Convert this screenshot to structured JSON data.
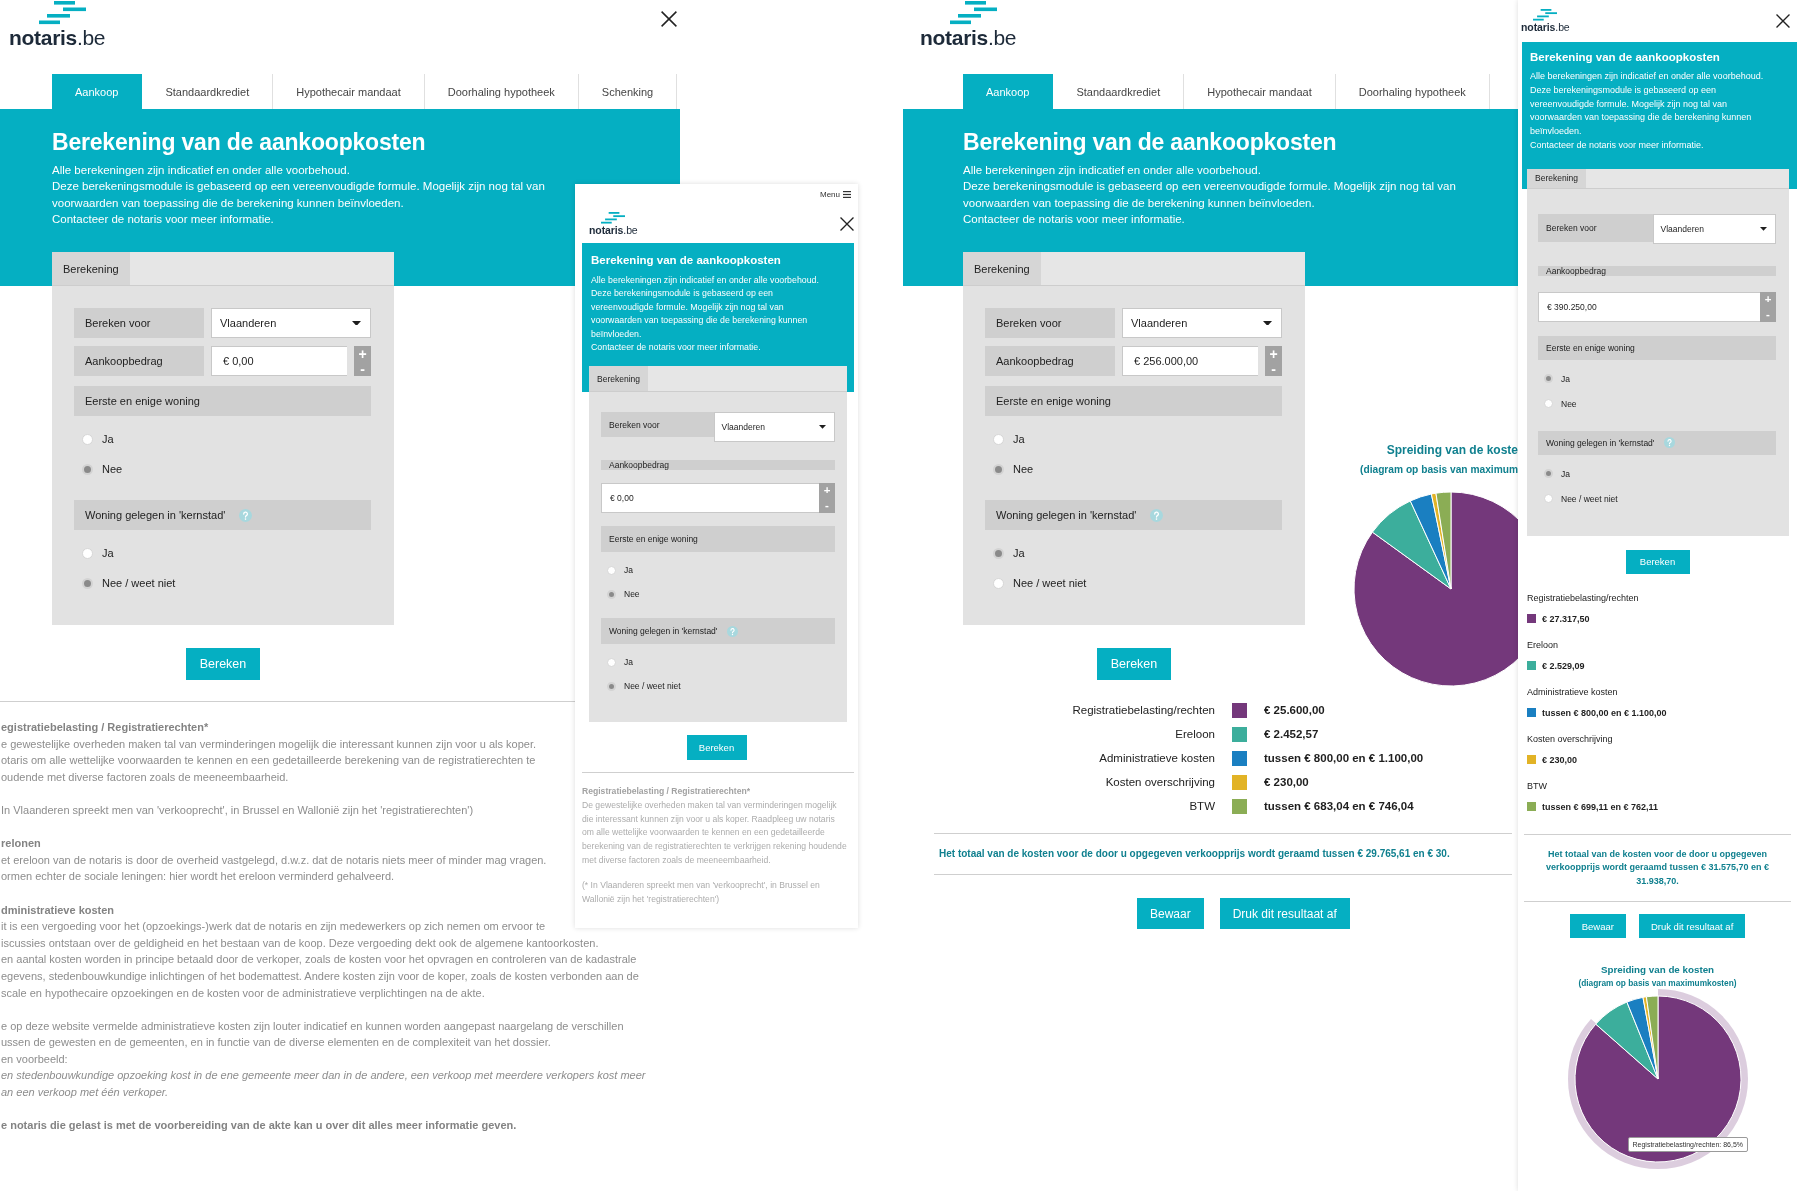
{
  "screens": [
    {
      "kind": "desktop",
      "logo": "**notaris**.be",
      "tabs": [
        {
          "label": "Aankoop",
          "selected": true
        },
        {
          "label": "Standaardkrediet",
          "selected": false
        },
        {
          "label": "Hypothecair mandaat",
          "selected": false
        },
        {
          "label": "Doorhaling hypotheek",
          "selected": false
        },
        {
          "label": "Schenking",
          "selected": false
        }
      ],
      "title": "Berekening van de aankoopkosten",
      "intro": [
        "Alle berekeningen zijn indicatief en onder alle voorbehoud.",
        "Deze berekeningsmodule is gebaseerd op een vereenvoudigde formule. Mogelijk zijn nog tal van voorwaarden van toepassing die de berekening kunnen beïnvloeden.",
        "Contacteer de notaris voor meer informatie."
      ],
      "form": {
        "tab": "Berekening",
        "region": {
          "label": "Bereken voor",
          "value": "Vlaanderen"
        },
        "amount": {
          "label": "Aankoopbedrag",
          "value": "€ 0,00",
          "step_up": "+",
          "step_down": "-"
        },
        "questions": [
          {
            "label": "Eerste en enige woning",
            "help": false,
            "options": [
              {
                "label": "Ja",
                "selected": false
              },
              {
                "label": "Nee",
                "selected": true
              }
            ]
          },
          {
            "label": "Woning gelegen in 'kernstad'",
            "help": true,
            "options": [
              {
                "label": "Ja",
                "selected": false
              },
              {
                "label": "Nee / weet niet",
                "selected": true
              }
            ]
          }
        ]
      },
      "submit": "Bereken",
      "info": [
        {
          "kind": "heading",
          "lines": [
            "egistratiebelasting / Registratierechten*"
          ]
        },
        {
          "kind": "paragraph",
          "lines": [
            "e gewestelijke overheden maken tal van verminderingen mogelijk die interessant kunnen zijn voor u als koper.",
            "otaris om alle wettelijke voorwaarden te kennen en een gedetailleerde berekening van de registratierechten te",
            "oudende met diverse factoren zoals de meeneembaarheid."
          ]
        },
        {
          "kind": "paragraph",
          "lines": [
            "In Vlaanderen spreekt men van 'verkooprecht', in Brussel en Wallonië zijn het 'registratierechten')"
          ]
        },
        {
          "kind": "heading",
          "lines": [
            "relonen"
          ]
        },
        {
          "kind": "paragraph",
          "lines": [
            "et ereloon van de notaris is door de overheid vastgelegd, d.w.z. dat de notaris niets meer of minder mag vragen.",
            "ormen echter de sociale leningen: hier wordt het ereloon verminderd gehalveerd."
          ]
        },
        {
          "kind": "heading",
          "lines": [
            "dministratieve kosten"
          ]
        },
        {
          "kind": "paragraph",
          "lines": [
            "it is een vergoeding voor het (opzoekings-)werk dat de notaris en zijn medewerkers op zich nemen om ervoor te",
            "iscussies ontstaan over de geldigheid en het bestaan van de koop. Deze vergoeding dekt ook de algemene kantoorkosten.",
            "en aantal kosten worden in principe betaald door de verkoper, zoals de kosten voor het opvragen en controleren van de kadastrale",
            "egevens, stedenbouwkundige inlichtingen of het bodemattest. Andere kosten zijn voor de koper, zoals de kosten verbonden aan de",
            "scale en hypothecaire opzoekingen en de kosten voor de administratieve verplichtingen na de akte."
          ]
        },
        {
          "kind": "paragraph",
          "lines": [
            "e op deze website vermelde administratieve kosten zijn louter indicatief en kunnen worden aangepast naargelang de verschillen",
            "ussen de gewesten en de gemeenten, en in functie van de diverse elementen en de complexiteit van het dossier.",
            "en voorbeeld:",
            "*en stedenbouwkundige opzoeking kost in de ene gemeente meer dan in de andere, een verkoop met meerdere verkopers kost meer*",
            "*an een verkoop met één verkoper.*"
          ]
        },
        {
          "kind": "closing",
          "lines": [
            "e notaris die gelast is met de voorbereiding van de akte kan u over dit alles meer informatie geven."
          ]
        }
      ]
    },
    {
      "kind": "phone",
      "menu": "Menu",
      "logo": "**notaris**.be",
      "title": "Berekening van de aankoopkosten",
      "intro": [
        "Alle berekeningen zijn indicatief en onder alle voorbehoud.",
        "Deze berekeningsmodule is gebaseerd op een vereenvoudigde formule. Mogelijk zijn nog tal van voorwaarden van toepassing die de berekening kunnen beïnvloeden.",
        "Contacteer de notaris voor meer informatie."
      ],
      "form": {
        "tab": "Berekening",
        "region": {
          "label": "Bereken voor",
          "value": "Vlaanderen"
        },
        "amount": {
          "label": "Aankoopbedrag",
          "value": "€ 0,00",
          "step_up": "+",
          "step_down": "-"
        },
        "questions": [
          {
            "label": "Eerste en enige woning",
            "help": false,
            "options": [
              {
                "label": "Ja",
                "selected": false
              },
              {
                "label": "Nee",
                "selected": true
              }
            ]
          },
          {
            "label": "Woning gelegen in 'kernstad'",
            "help": true,
            "options": [
              {
                "label": "Ja",
                "selected": false
              },
              {
                "label": "Nee / weet niet",
                "selected": true
              }
            ]
          }
        ]
      },
      "submit": "Bereken",
      "info": [
        {
          "kind": "heading",
          "lines": [
            "Registratiebelasting / Registratierechten*"
          ]
        },
        {
          "kind": "paragraph",
          "lines": [
            "De gewestelijke overheden maken tal van verminderingen mogelijk die interessant kunnen zijn voor u als koper. Raadpleeg uw notaris om alle wettelijke voorwaarden te kennen en een gedetailleerde berekening van de registratierechten te verkrijgen rekening houdende met diverse factoren zoals de meeneembaarheid."
          ]
        },
        {
          "kind": "paragraph",
          "lines": [
            "(* In Vlaanderen spreekt men van 'verkooprecht', in Brussel en Wallonië zijn het 'registratierechten')"
          ]
        }
      ]
    },
    {
      "kind": "desktop",
      "logo": "**notaris**.be",
      "tabs": [
        {
          "label": "Aankoop",
          "selected": true
        },
        {
          "label": "Standaardkrediet",
          "selected": false
        },
        {
          "label": "Hypothecair mandaat",
          "selected": false
        },
        {
          "label": "Doorhaling hypotheek",
          "selected": false
        }
      ],
      "title": "Berekening van de aankoopkosten",
      "intro": [
        "Alle berekeningen zijn indicatief en onder alle voorbehoud.",
        "Deze berekeningsmodule is gebaseerd op een vereenvoudigde formule. Mogelijk zijn nog tal van voorwaarden van toepassing die de berekening kunnen beïnvloeden.",
        "Contacteer de notaris voor meer informatie."
      ],
      "form": {
        "tab": "Berekening",
        "region": {
          "label": "Bereken voor",
          "value": "Vlaanderen"
        },
        "amount": {
          "label": "Aankoopbedrag",
          "value": "€ 256.000,00",
          "step_up": "+",
          "step_down": "-"
        },
        "questions": [
          {
            "label": "Eerste en enige woning",
            "help": false,
            "options": [
              {
                "label": "Ja",
                "selected": false
              },
              {
                "label": "Nee",
                "selected": true
              }
            ]
          },
          {
            "label": "Woning gelegen in 'kernstad'",
            "help": true,
            "options": [
              {
                "label": "Ja",
                "selected": true
              },
              {
                "label": "Nee / weet niet",
                "selected": false
              }
            ]
          }
        ]
      },
      "submit": "Bereken",
      "chart": {
        "subtitle": "(diagram op basis van maximum",
        "chart_data": {
          "type": "pie",
          "title": "Spreiding van de koste",
          "values": [
            84.97,
            8.14,
            3.65,
            0.76,
            2.48
          ]
        }
      },
      "results": {
        "items": [
          {
            "label": "Registratiebelasting/rechten",
            "color": "#74387b",
            "value": "€ 25.600,00"
          },
          {
            "label": "Ereloon",
            "color": "#3cae9c",
            "value": "€ 2.452,57"
          },
          {
            "label": "Administratieve kosten",
            "color": "#1a7fc1",
            "value": "tussen € 800,00 en € 1.100,00"
          },
          {
            "label": "Kosten overschrijving",
            "color": "#e2b326",
            "value": "€ 230,00"
          },
          {
            "label": "BTW",
            "color": "#8bad55",
            "value": "tussen € 683,04 en € 746,04"
          }
        ],
        "total": "Het totaal van de kosten voor de door u opgegeven verkoopprijs wordt geraamd tussen € 29.765,61 en € 30.",
        "actions": [
          "Bewaar",
          "Druk dit resultaat af"
        ]
      }
    },
    {
      "kind": "phone",
      "logo": "**notaris**.be",
      "title": "Berekening van de aankoopkosten",
      "intro": [
        "Alle berekeningen zijn indicatief en onder alle voorbehoud.",
        "Deze berekeningsmodule is gebaseerd op een vereenvoudigde formule. Mogelijk zijn nog tal van voorwaarden van toepassing die de berekening kunnen beïnvloeden.",
        "Contacteer de notaris voor meer informatie."
      ],
      "form": {
        "tab": "Berekening",
        "region": {
          "label": "Bereken voor",
          "value": "Vlaanderen"
        },
        "amount": {
          "label": "Aankoopbedrag",
          "value": "€ 390.250,00",
          "step_up": "+",
          "step_down": "-"
        },
        "questions": [
          {
            "label": "Eerste en enige woning",
            "help": false,
            "options": [
              {
                "label": "Ja",
                "selected": true
              },
              {
                "label": "Nee",
                "selected": false
              }
            ]
          },
          {
            "label": "Woning gelegen in 'kernstad'",
            "help": true,
            "options": [
              {
                "label": "Ja",
                "selected": true
              },
              {
                "label": "Nee / weet niet",
                "selected": false
              }
            ]
          }
        ]
      },
      "submit": "Bereken",
      "results": {
        "items": [
          {
            "label": "Registratiebelasting/rechten",
            "color": "#74387b",
            "value": "€ 27.317,50"
          },
          {
            "label": "Ereloon",
            "color": "#3cae9c",
            "value": "€ 2.529,09"
          },
          {
            "label": "Administratieve kosten",
            "color": "#1a7fc1",
            "value": "tussen € 800,00 en € 1.100,00"
          },
          {
            "label": "Kosten overschrijving",
            "color": "#e2b326",
            "value": "€ 230,00"
          },
          {
            "label": "BTW",
            "color": "#8bad55",
            "value": "tussen € 699,11 en € 762,11"
          }
        ],
        "total": "Het totaal van de kosten voor de door u opgegeven verkoopprijs wordt geraamd tussen € 31.575,70 en € 31.938,70.",
        "actions": [
          "Bewaar",
          "Druk dit resultaat af"
        ]
      },
      "chart": {
        "subtitle": "(diagram op basis van maximumkosten)",
        "tooltip": "Registratiebelasting/rechten: 86,5%",
        "chart_data": {
          "type": "pie",
          "title": "Spreiding van de kosten",
          "values": [
            86.5,
            7.39,
            3.21,
            0.67,
            2.23
          ]
        }
      }
    }
  ]
}
